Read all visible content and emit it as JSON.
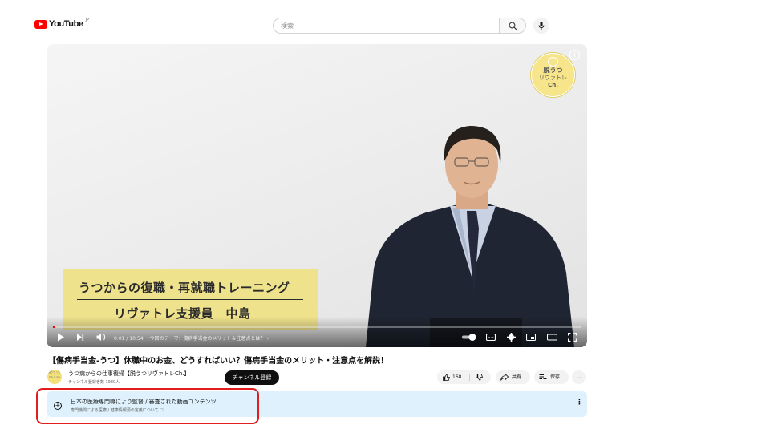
{
  "header": {
    "logo_text": "YouTube",
    "logo_sup": "JP",
    "search_placeholder": "検索",
    "icons": [
      "search-icon",
      "mic-icon"
    ]
  },
  "player": {
    "badge": {
      "line1": "脱うつ",
      "line2": "リヴァトレ",
      "line3": "Ch."
    },
    "info_label": "i",
    "caption_line1": "うつからの復職・再就職トレーニング",
    "caption_line2": "リヴァトレ支援員　中島",
    "time": "0:01 / 10:54",
    "chapter": "・今回のテーマ：傷病手当金のメリット＆注意点とは？ ›",
    "progress_fraction": 0.0015,
    "icons": [
      "play-icon",
      "next-icon",
      "volume-icon",
      "autoplay-toggle",
      "subtitles-icon",
      "settings-icon",
      "miniplayer-icon",
      "theater-icon",
      "fullscreen-icon"
    ]
  },
  "video": {
    "title": "【傷病手当金-うつ】休職中のお金、どうすればいい？傷病手当金のメリット・注意点を解説！",
    "channel_name": "うつ病からの仕事復帰【脱うつリヴァトレCh.】",
    "avatar_text": "脱うつ リヴァトレ Ch.",
    "subscribers": "チャンネル登録者数 1980人",
    "subscribe_label": "チャンネル登録",
    "like_count": "168",
    "share_label": "共有",
    "save_label": "保存",
    "more_label": "…"
  },
  "notice": {
    "title": "日本の医療専門職により監督 / 審査された動画コンテンツ",
    "subtitle": "専門機関による医療 / 健康情報源の定義について ☐",
    "menu": "⋮"
  },
  "colors": {
    "accent_red": "#ff0000",
    "highlight": "#e11d1d",
    "caption_bg": "#efe28c",
    "notice_bg": "#def1fc"
  }
}
